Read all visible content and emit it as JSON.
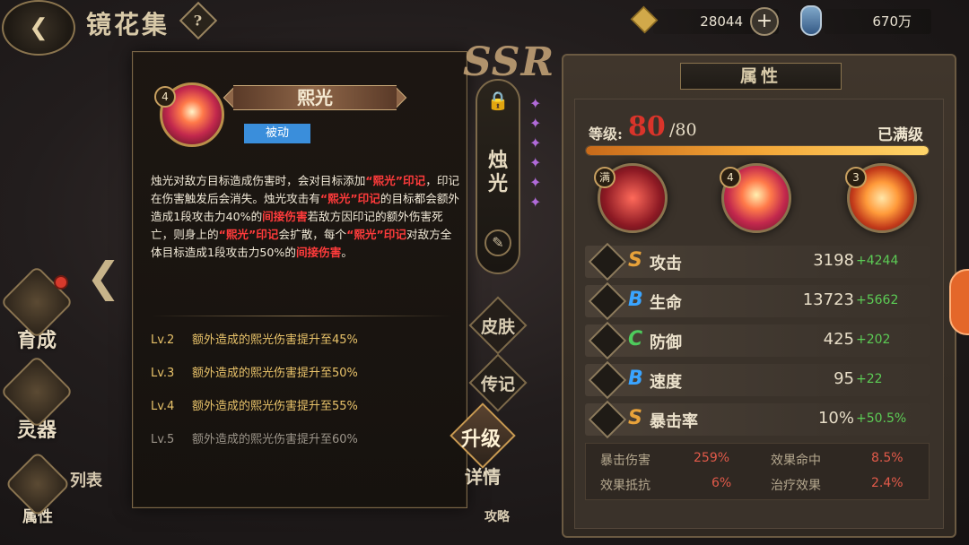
{
  "header": {
    "title": "镜花集",
    "help_label": "?",
    "coins": "28044",
    "add_label": "+",
    "potions": "670万"
  },
  "nav": {
    "growth": "育成",
    "artifact": "灵器",
    "attributes": "属性",
    "list": "列表"
  },
  "skill_popup": {
    "level_badge": "4",
    "name": "熙光",
    "type": "被动",
    "desc": [
      {
        "t": "烛光对敌方目标造成伤害时，会对目标添加",
        "red": false
      },
      {
        "t": "“熙光”印记",
        "red": true
      },
      {
        "t": "，印记在伤害触发后会消失。烛光攻击有",
        "red": false
      },
      {
        "t": "“熙光”印记",
        "red": true
      },
      {
        "t": "的目标都会额外造成1段攻击力40%的",
        "red": false
      },
      {
        "t": "间接伤害",
        "red": true
      },
      {
        "t": "若敌方因印记的额外伤害死亡，则身上的",
        "red": false
      },
      {
        "t": "“熙光”印记",
        "red": true
      },
      {
        "t": "会扩散，每个",
        "red": false
      },
      {
        "t": "“熙光”印记",
        "red": true
      },
      {
        "t": "对敌方全体目标造成1段攻击力50%的",
        "red": false
      },
      {
        "t": "间接伤害",
        "red": true
      },
      {
        "t": "。",
        "red": false
      }
    ],
    "levels": [
      {
        "lv": "Lv.2",
        "text": "额外造成的熙光伤害提升至45%",
        "unlocked": true
      },
      {
        "lv": "Lv.3",
        "text": "额外造成的熙光伤害提升至50%",
        "unlocked": true
      },
      {
        "lv": "Lv.4",
        "text": "额外造成的熙光伤害提升至55%",
        "unlocked": true
      },
      {
        "lv": "Lv.5",
        "text": "额外造成的熙光伤害提升至60%",
        "unlocked": false
      }
    ]
  },
  "character": {
    "rarity": "SSR",
    "name": "烛光",
    "skin": "皮肤",
    "biography": "传记",
    "upgrade": "升级",
    "details": "详情",
    "guide": "攻略"
  },
  "attr_panel": {
    "title": "属性",
    "level_label": "等级:",
    "level": "80",
    "level_max": "/80",
    "level_status": "已满级",
    "xp_fraction": 1.0,
    "skill_badges": [
      "满",
      "4",
      "3"
    ],
    "stats": [
      {
        "grade": "S",
        "grade_class": "grade-s",
        "name": "攻击",
        "value": "3198",
        "bonus": "+4244",
        "icon": "attack-icon"
      },
      {
        "grade": "B",
        "grade_class": "grade-b",
        "name": "生命",
        "value": "13723",
        "bonus": "+5662",
        "icon": "health-icon"
      },
      {
        "grade": "C",
        "grade_class": "grade-c",
        "name": "防御",
        "value": "425",
        "bonus": "+202",
        "icon": "defense-icon"
      },
      {
        "grade": "B",
        "grade_class": "grade-b",
        "name": "速度",
        "value": "95",
        "bonus": "+22",
        "icon": "speed-icon"
      },
      {
        "grade": "S",
        "grade_class": "grade-s",
        "name": "暴击率",
        "value": "10%",
        "bonus": "+50.5%",
        "icon": "crit-icon"
      }
    ],
    "substats": [
      {
        "name": "暴击伤害",
        "value": "259%"
      },
      {
        "name": "效果命中",
        "value": "8.5%"
      },
      {
        "name": "效果抵抗",
        "value": "6%"
      },
      {
        "name": "治疗效果",
        "value": "2.4%"
      }
    ]
  },
  "colors": {
    "accent_gold": "#c9a979",
    "level_red": "#d9342a",
    "bonus_green": "#5ccc55",
    "type_tag_blue": "#3a8edb"
  }
}
